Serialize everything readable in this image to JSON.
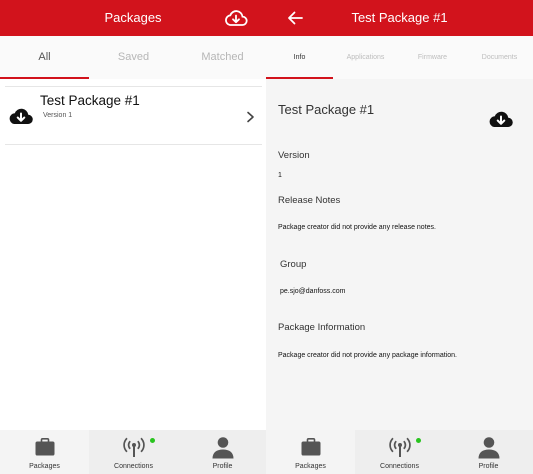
{
  "left": {
    "appbar": {
      "title": "Packages",
      "action_icon": "cloud-download-icon"
    },
    "tabs": [
      {
        "label": "All",
        "active": true
      },
      {
        "label": "Saved",
        "active": false
      },
      {
        "label": "Matched",
        "active": false
      }
    ],
    "packages": [
      {
        "title": "Test Package #1",
        "version": "Version 1"
      }
    ]
  },
  "right": {
    "appbar": {
      "title": "Test Package #1",
      "back_icon": "arrow-left-icon"
    },
    "tabs": [
      {
        "label": "Info",
        "active": true
      },
      {
        "label": "Applications",
        "active": false
      },
      {
        "label": "Firmware",
        "active": false
      },
      {
        "label": "Documents",
        "active": false
      }
    ],
    "detail": {
      "title": "Test Package #1",
      "version_label": "Version",
      "version_value": "1",
      "release_notes_label": "Release Notes",
      "release_notes_value": "Package creator did not provide any release notes.",
      "group_label": "Group",
      "group_value": "pe.sjo@danfoss.com",
      "package_info_label": "Package Information",
      "package_info_value": "Package creator did not provide any package information."
    }
  },
  "bottom_nav": [
    {
      "label": "Packages",
      "icon": "briefcase-icon"
    },
    {
      "label": "Connections",
      "icon": "antenna-icon",
      "status": "connected"
    },
    {
      "label": "Profile",
      "icon": "person-icon"
    }
  ],
  "colors": {
    "brand": "#d2131c",
    "status_dot": "#29c41f"
  }
}
